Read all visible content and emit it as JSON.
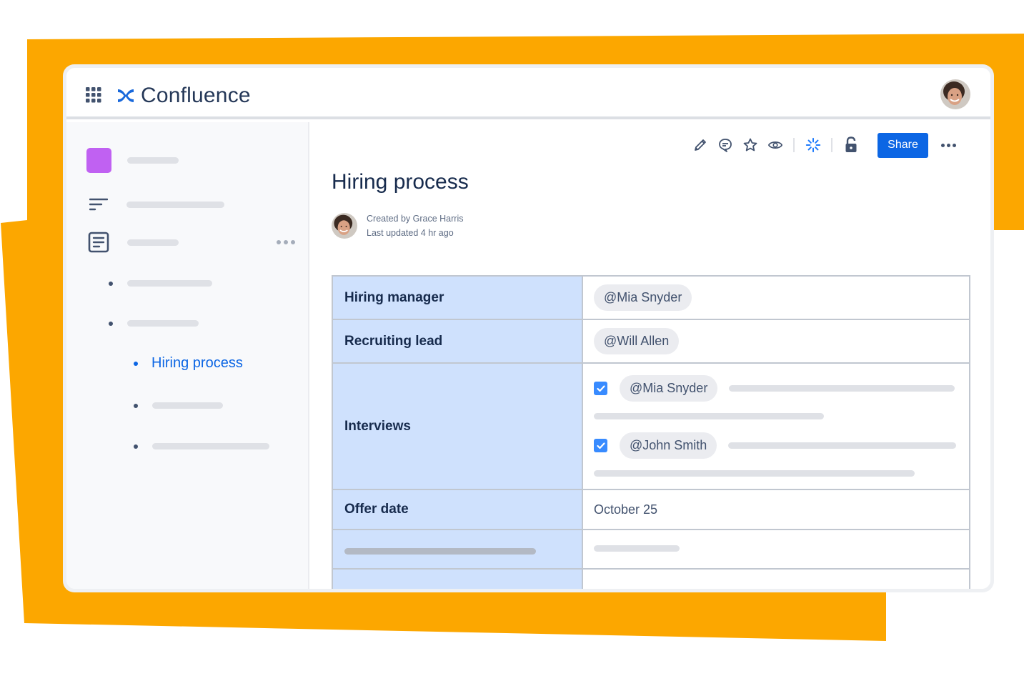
{
  "app": {
    "name": "Confluence",
    "brand_color": "#1868DB",
    "accent_background": "#FCA700"
  },
  "topbar": {
    "apps_icon": "grid-icon",
    "logo_icon": "confluence-logo-icon",
    "logo_text": "Confluence",
    "avatar": "user-avatar"
  },
  "sidebar": {
    "space_icon_color": "#C061F2",
    "items": [
      {
        "icon": "space-square-icon",
        "label_placeholder": true
      },
      {
        "icon": "filter-lines-icon",
        "label_placeholder": true
      },
      {
        "icon": "page-icon",
        "label_placeholder": true,
        "has_more": true
      }
    ],
    "tree": [
      {
        "level": 1,
        "label": null
      },
      {
        "level": 1,
        "label": null
      },
      {
        "level": 2,
        "label": "Hiring process",
        "active": true
      },
      {
        "level": 2,
        "label": null
      },
      {
        "level": 2,
        "label": null
      }
    ],
    "active_item_label": "Hiring process"
  },
  "toolbar": {
    "icons": [
      "edit-icon",
      "comment-icon",
      "star-icon",
      "watch-icon",
      "loom-icon",
      "unlock-icon"
    ],
    "share_label": "Share",
    "more_icon": "more-icon"
  },
  "page": {
    "title": "Hiring process",
    "created_by_label": "Created by",
    "created_by": "Grace Harris",
    "last_updated_label": "Last updated",
    "last_updated": "4 hr ago"
  },
  "table": {
    "rows": [
      {
        "header": "Hiring manager",
        "mention": "@Mia Snyder"
      },
      {
        "header": "Recruiting lead",
        "mention": "@Will Allen"
      },
      {
        "header": "Interviews",
        "tasks": [
          {
            "checked": true,
            "mention": "@Mia Snyder"
          },
          {
            "checked": true,
            "mention": "@John Smith"
          }
        ]
      },
      {
        "header": "Offer date",
        "value": "October 25"
      }
    ]
  }
}
